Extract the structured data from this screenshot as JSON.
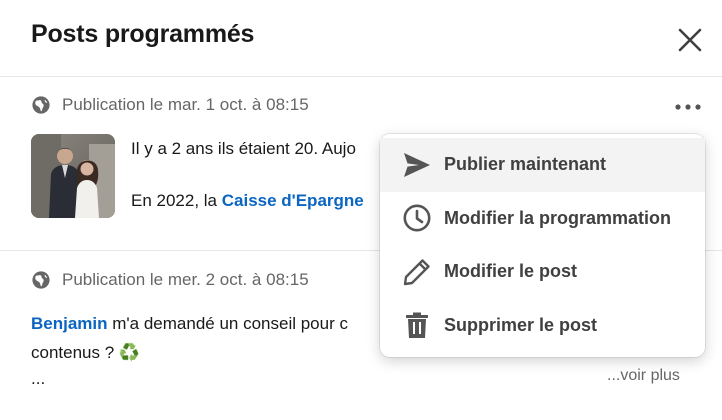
{
  "header": {
    "title": "Posts programmés"
  },
  "posts": [
    {
      "meta": "Publication le mar. 1 oct. à 08:15",
      "line1": "Il y a 2 ans ils étaient 20. Aujo",
      "line2_prefix": "En 2022, la ",
      "line2_link": "Caisse d'Epargne"
    },
    {
      "meta": "Publication le mer. 2 oct. à 08:15",
      "mention": "Benjamin",
      "line1_rest": " m'a demandé un conseil pour c",
      "line2": "contenus ? ♻️",
      "line3": "...",
      "see_more": "...voir plus"
    }
  ],
  "menu": {
    "items": [
      {
        "label": "Publier maintenant",
        "icon": "send-icon"
      },
      {
        "label": "Modifier la programmation",
        "icon": "clock-icon"
      },
      {
        "label": "Modifier le post",
        "icon": "pencil-icon"
      },
      {
        "label": "Supprimer le post",
        "icon": "trash-icon"
      }
    ]
  },
  "colors": {
    "link": "#0a66c2",
    "muted": "#666666",
    "menu_active": "#f3f3f3"
  }
}
